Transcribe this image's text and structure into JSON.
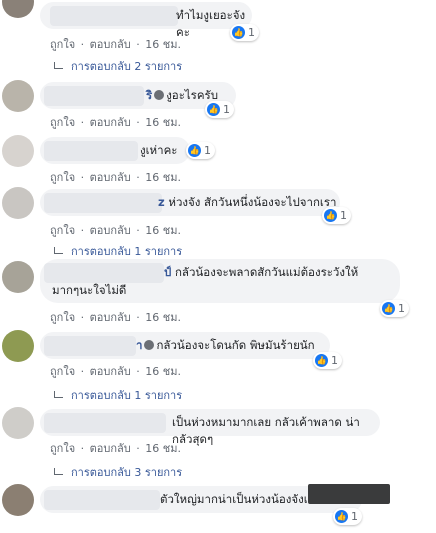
{
  "like_color": "#1877f2",
  "actions": {
    "like": "ถูกใจ",
    "dot": "·",
    "reply": "ตอบกลับ",
    "time": "16 ชม."
  },
  "comments": [
    {
      "text": "ทำไมงูเยอะจังคะ",
      "reacts": "1",
      "replies": "การตอบกลับ 2 รายการ",
      "author_suffix": ""
    },
    {
      "text": "งูอะไรครับ",
      "reacts": "1",
      "replies": "",
      "author_suffix": "ริ"
    },
    {
      "text": "งูเห่าคะ",
      "reacts": "1",
      "replies": "",
      "author_suffix": ""
    },
    {
      "text": "ห่วงจัง สักวันหนึ่งน้องจะไปจากเรา",
      "reacts": "1",
      "replies": "การตอบกลับ 1 รายการ",
      "author_suffix": "z"
    },
    {
      "text_line1": "กลัวน้องจะพลาดสักวันแม่ต้องระวังให้",
      "text_line2": "มากๆนะใจไม่ดี",
      "reacts": "1",
      "replies": "",
      "author_suffix": "ป์"
    },
    {
      "text": "กลัวน้องจะโดนกัด พิษมันร้ายนัก",
      "reacts": "1",
      "replies": "การตอบกลับ 1 รายการ",
      "author_suffix": "า"
    },
    {
      "text": "เป็นห่วงหมามากเลย กลัวเค้าพลาด น่ากลัวสุดๆ",
      "reacts": "1",
      "replies": "การตอบกลับ 3 รายการ",
      "author_suffix": ""
    },
    {
      "text": "ตัวใหญ่มากน่าเป็นห่วงน้องจังเลย",
      "reacts": "1",
      "replies": "",
      "author_suffix": ""
    }
  ]
}
